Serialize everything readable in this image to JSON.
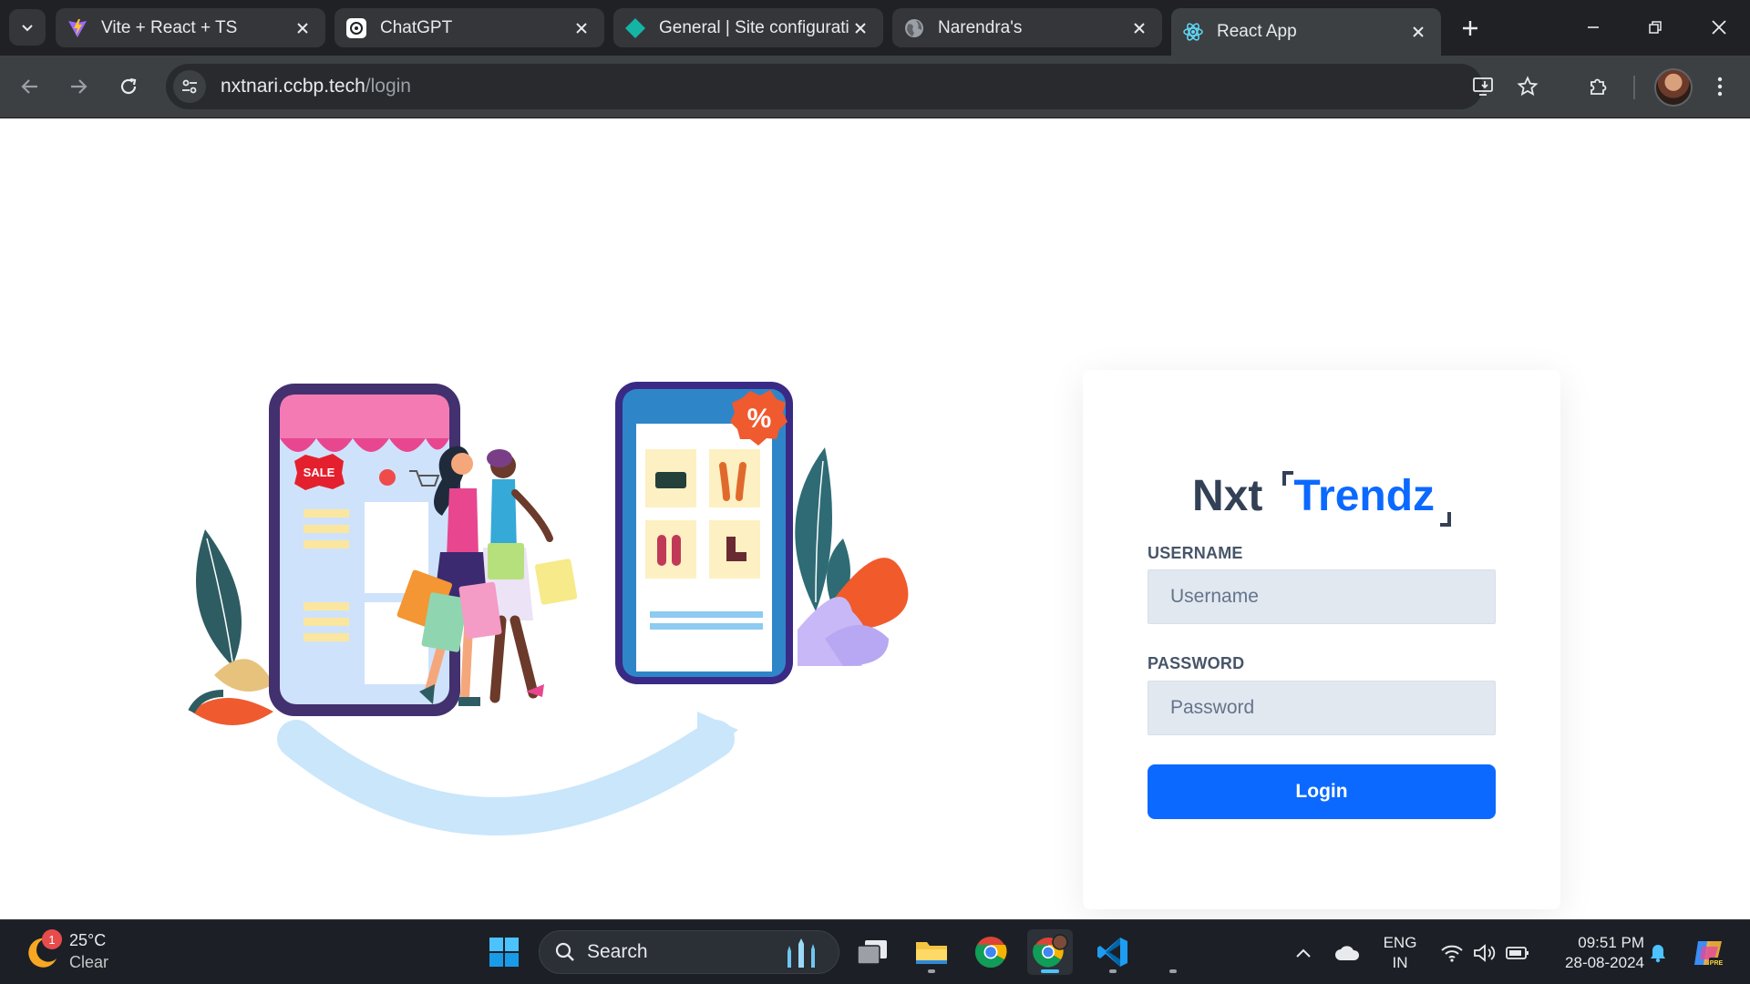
{
  "browser": {
    "tabs": [
      {
        "title": "Vite + React + TS",
        "icon": "vite-icon",
        "active": false
      },
      {
        "title": "ChatGPT",
        "icon": "chatgpt-icon",
        "active": false
      },
      {
        "title": "General | Site configuratio",
        "icon": "netlify-icon",
        "active": false
      },
      {
        "title": "Narendra's",
        "icon": "globe-icon",
        "active": false
      },
      {
        "title": "React App",
        "icon": "react-icon",
        "active": true
      }
    ],
    "url_host": "nxtnari.ccbp.tech",
    "url_path": "/login"
  },
  "login": {
    "logo_primary": "Nxt",
    "logo_secondary": "Trendz",
    "username_label": "USERNAME",
    "username_placeholder": "Username",
    "password_label": "PASSWORD",
    "password_placeholder": "Password",
    "login_button": "Login"
  },
  "illustration": {
    "sale_badge": "SALE",
    "discount_badge": "%"
  },
  "taskbar": {
    "weather_temp": "25°C",
    "weather_condition": "Clear",
    "weather_badge_count": "1",
    "search_label": "Search",
    "language_line1": "ENG",
    "language_line2": "IN",
    "time": "09:51 PM",
    "date": "28-08-2024"
  },
  "colors": {
    "brand_blue": "#0b69ff",
    "brand_dark": "#334155",
    "tab_strip": "#202124",
    "toolbar": "#3c4043",
    "taskbar": "#1c2026"
  }
}
